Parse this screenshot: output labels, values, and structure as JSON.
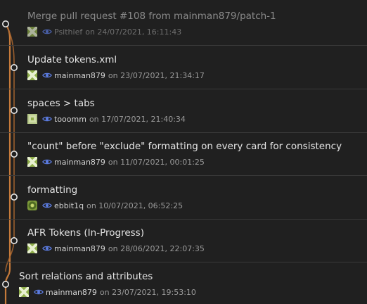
{
  "colors": {
    "background": "#202020",
    "separator": "#3a3a3a",
    "graph_line_main": "#c57a3a",
    "graph_line_dim": "#8a6a4a",
    "node_fill": "#202020",
    "node_stroke": "#e6e6e6",
    "eye_icon": "#5b7be0"
  },
  "commits": [
    {
      "title": "Merge pull request #108 from mainman879/patch-1",
      "author": "Psithief",
      "date_text": "on 24/07/2021, 16:11:43",
      "avatar_icon": "identicon-avatar",
      "state": "dimmed"
    },
    {
      "title": "Update tokens.xml",
      "author": "mainman879",
      "date_text": "on 23/07/2021, 21:34:17",
      "avatar_icon": "identicon-avatar"
    },
    {
      "title": "spaces > tabs",
      "author": "tooomm",
      "date_text": "on 17/07/2021, 21:40:34",
      "avatar_icon": "identicon-avatar"
    },
    {
      "title": "\"count\" before \"exclude\" formatting on every card for consistency",
      "author": "mainman879",
      "date_text": "on 11/07/2021, 00:01:25",
      "avatar_icon": "identicon-avatar"
    },
    {
      "title": "formatting",
      "author": "ebbit1q",
      "date_text": "on 10/07/2021, 06:52:25",
      "avatar_icon": "photo-avatar"
    },
    {
      "title": "AFR Tokens (In-Progress)",
      "author": "mainman879",
      "date_text": "on 28/06/2021, 22:07:35",
      "avatar_icon": "identicon-avatar"
    },
    {
      "title": "Sort relations and attributes",
      "author": "mainman879",
      "date_text": "on 23/07/2021, 19:53:10",
      "avatar_icon": "identicon-avatar"
    }
  ],
  "icons": {
    "graph_node": "commit-node-icon",
    "view": "eye-icon"
  }
}
